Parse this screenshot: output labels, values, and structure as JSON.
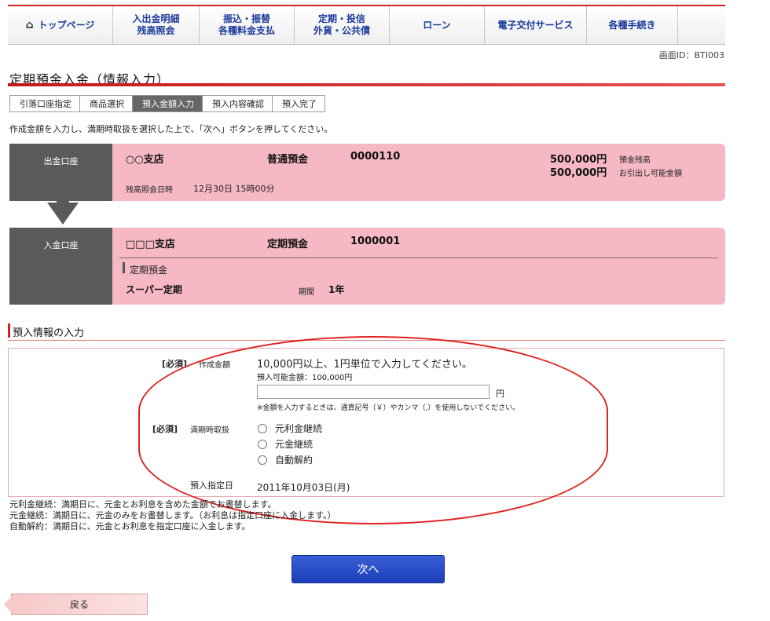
{
  "nav": {
    "items": [
      {
        "label": "トップページ",
        "icon": "home-icon"
      },
      {
        "label": "入出金明細\n残高照会"
      },
      {
        "label": "振込・振替\n各種料金支払"
      },
      {
        "label": "定期・投信\n外貨・公共債"
      },
      {
        "label": "ローン"
      },
      {
        "label": "電子交付サービス"
      },
      {
        "label": "各種手続き"
      }
    ]
  },
  "screen_id": "画面ID：BTI003",
  "page_title": "定期預金入金（情報入力）",
  "steps": [
    "引落口座指定",
    "商品選択",
    "預入金額入力",
    "預入内容確認",
    "預入完了"
  ],
  "active_step": 2,
  "instruction": "作成金額を入力し、満期時取扱を選択した上で、「次へ」ボタンを押してください。",
  "withdrawal": {
    "label": "出金口座",
    "branch": "○○支店",
    "type": "普通預金",
    "number": "0000110",
    "balance": "500,000円",
    "balance_label": "預金残高",
    "available": "500,000円",
    "available_label": "お引出し可能金額",
    "inquiry_label": "残高照会日時",
    "inquiry_time": "12月30日 15時00分"
  },
  "deposit": {
    "label": "入金口座",
    "branch": "□□□支店",
    "type": "定期預金",
    "number": "1000001",
    "sub_heading": "定期預金",
    "product": "スーパー定期",
    "period_label": "期間",
    "period": "1年"
  },
  "section_title": "預入情報の入力",
  "form": {
    "required": "[必須]",
    "amount_label": "作成金額",
    "amount_guide": "10,000円以上、1円単位で入力してください。",
    "amount_available": "預入可能金額：100,000円",
    "amount_value": "",
    "amount_unit": "円",
    "amount_note": "※金額を入力するときは、通貨記号（￥）やカンマ（,）を使用しないでください。",
    "maturity_label": "満期時取扱",
    "options": [
      "元利金継続",
      "元金継続",
      "自動解約"
    ],
    "date_label": "預入指定日",
    "date_value": "2011年10月03日(月)"
  },
  "notes": [
    "元利金継続：満期日に、元金とお利息を含めた金額でお書替します。",
    "元金継続：満期日に、元金のみをお書替します。（お利息は指定口座に入金します。）",
    "自動解約：満期日に、元金とお利息を指定口座に入金します。"
  ],
  "buttons": {
    "next": "次へ",
    "back": "戻る"
  },
  "colors": {
    "accent_red": "#d02020",
    "pink_panel": "#f5b8c4",
    "label_gray": "#5a5a5a",
    "next_blue": "#1b3fb8"
  }
}
